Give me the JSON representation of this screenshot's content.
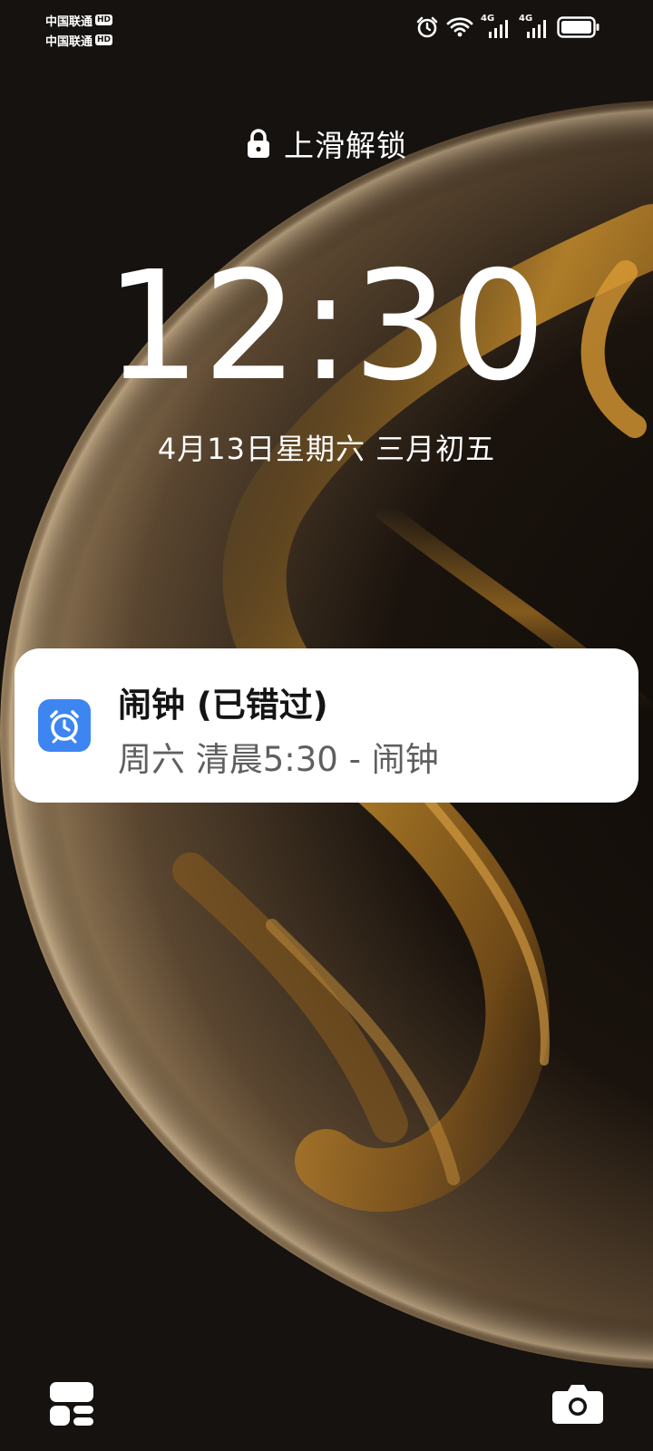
{
  "status_bar": {
    "carriers": [
      {
        "name": "中国联通",
        "badge": "HD"
      },
      {
        "name": "中国联通",
        "badge": "HD"
      }
    ],
    "icons": [
      "alarm-icon",
      "wifi-icon",
      "signal-4g-icon",
      "signal-4g-icon",
      "battery-icon"
    ],
    "signal_labels": [
      "4G",
      "4G"
    ]
  },
  "lockscreen": {
    "unlock_hint": "上滑解锁",
    "time": "12:30",
    "date": "4月13日星期六 三月初五"
  },
  "notification": {
    "app_icon": "alarm-clock-icon",
    "title": "闹钟 (已错过)",
    "body": "周六 清晨5:30 - 闹钟",
    "icon_color": "#3d85f0"
  },
  "shortcuts": {
    "left_icon": "widgets-icon",
    "right_icon": "camera-icon"
  }
}
